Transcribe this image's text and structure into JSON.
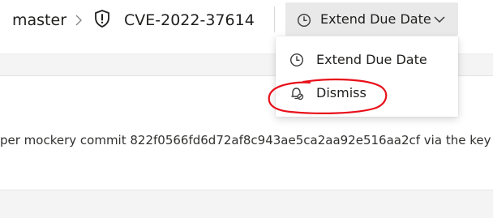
{
  "header": {
    "branch": "master",
    "alert_id": "CVE-2022-37614",
    "action_button_label": "Extend Due Date"
  },
  "menu": {
    "items": [
      {
        "label": "Extend Due Date",
        "icon": "clock-icon"
      },
      {
        "label": "Dismiss",
        "icon": "dismiss-bell-icon"
      }
    ]
  },
  "content": {
    "description": "per mockery commit 822f0566fd6d72af8c943ae5ca2aa92e516aa2cf via the key"
  },
  "colors": {
    "annotation": "#e8101a",
    "button_bg": "#e9e9e9",
    "icon": "#3b3a39"
  }
}
